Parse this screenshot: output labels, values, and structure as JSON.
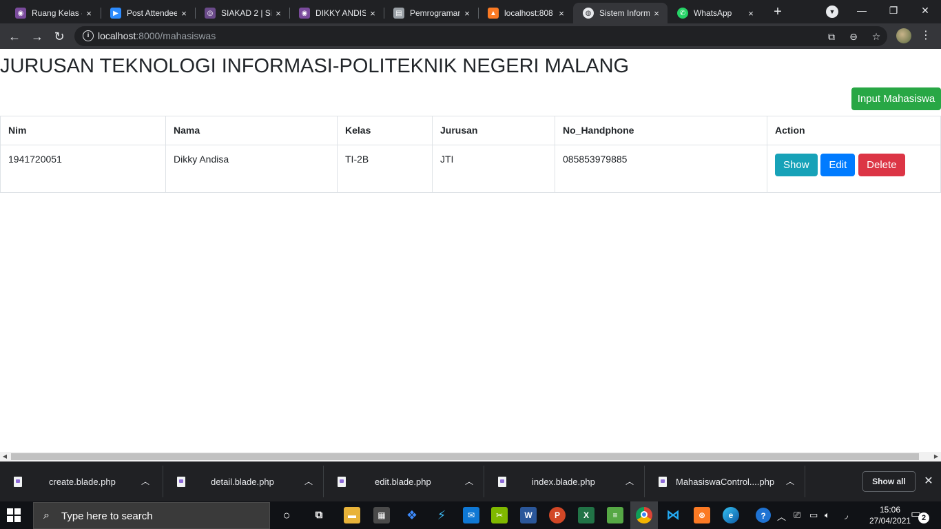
{
  "browser": {
    "tabs": [
      {
        "title": "Ruang Kelas - ",
        "icon": "polinema-icon",
        "color": "#7a4b9c"
      },
      {
        "title": "Post Attendee",
        "icon": "zoom-icon",
        "color": "#2d8cff"
      },
      {
        "title": "SIAKAD 2 | Sis",
        "icon": "siakad-icon",
        "color": "#6a4a8a"
      },
      {
        "title": "DIKKY ANDISA",
        "icon": "polinema-icon",
        "color": "#7a4b9c"
      },
      {
        "title": "Pemrograman",
        "icon": "doc-icon",
        "color": "#9aa0a6"
      },
      {
        "title": "localhost:808",
        "icon": "xampp-icon",
        "color": "#fb7a24"
      },
      {
        "title": "Sistem Inform",
        "icon": "globe-icon",
        "color": "#e8eaed"
      },
      {
        "title": "WhatsApp",
        "icon": "whatsapp-icon",
        "color": "#25d366"
      }
    ],
    "active_tab": 6,
    "tab_close": "×",
    "new_tab": "+",
    "url_host": "localhost",
    "url_path": ":8000/mahasiswas"
  },
  "page": {
    "title": "JURUSAN TEKNOLOGI INFORMASI-POLITEKNIK NEGERI MALANG",
    "input_button": "Input Mahasiswa",
    "table": {
      "headers": [
        "Nim",
        "Nama",
        "Kelas",
        "Jurusan",
        "No_Handphone",
        "Action"
      ],
      "rows": [
        {
          "nim": "1941720051",
          "nama": "Dikky Andisa",
          "kelas": "TI-2B",
          "jurusan": "JTI",
          "no_hp": "085853979885"
        }
      ],
      "actions": {
        "show": "Show",
        "edit": "Edit",
        "delete": "Delete"
      }
    },
    "colors": {
      "success": "#28a745",
      "info": "#17a2b8",
      "primary": "#007bff",
      "danger": "#dc3545"
    }
  },
  "downloads": {
    "items": [
      "create.blade.php",
      "detail.blade.php",
      "edit.blade.php",
      "index.blade.php",
      "MahasiswaControl....php"
    ],
    "show_all": "Show all"
  },
  "taskbar": {
    "search_placeholder": "Type here to search",
    "time": "15:06",
    "date": "27/04/2021",
    "notification_count": "2"
  }
}
